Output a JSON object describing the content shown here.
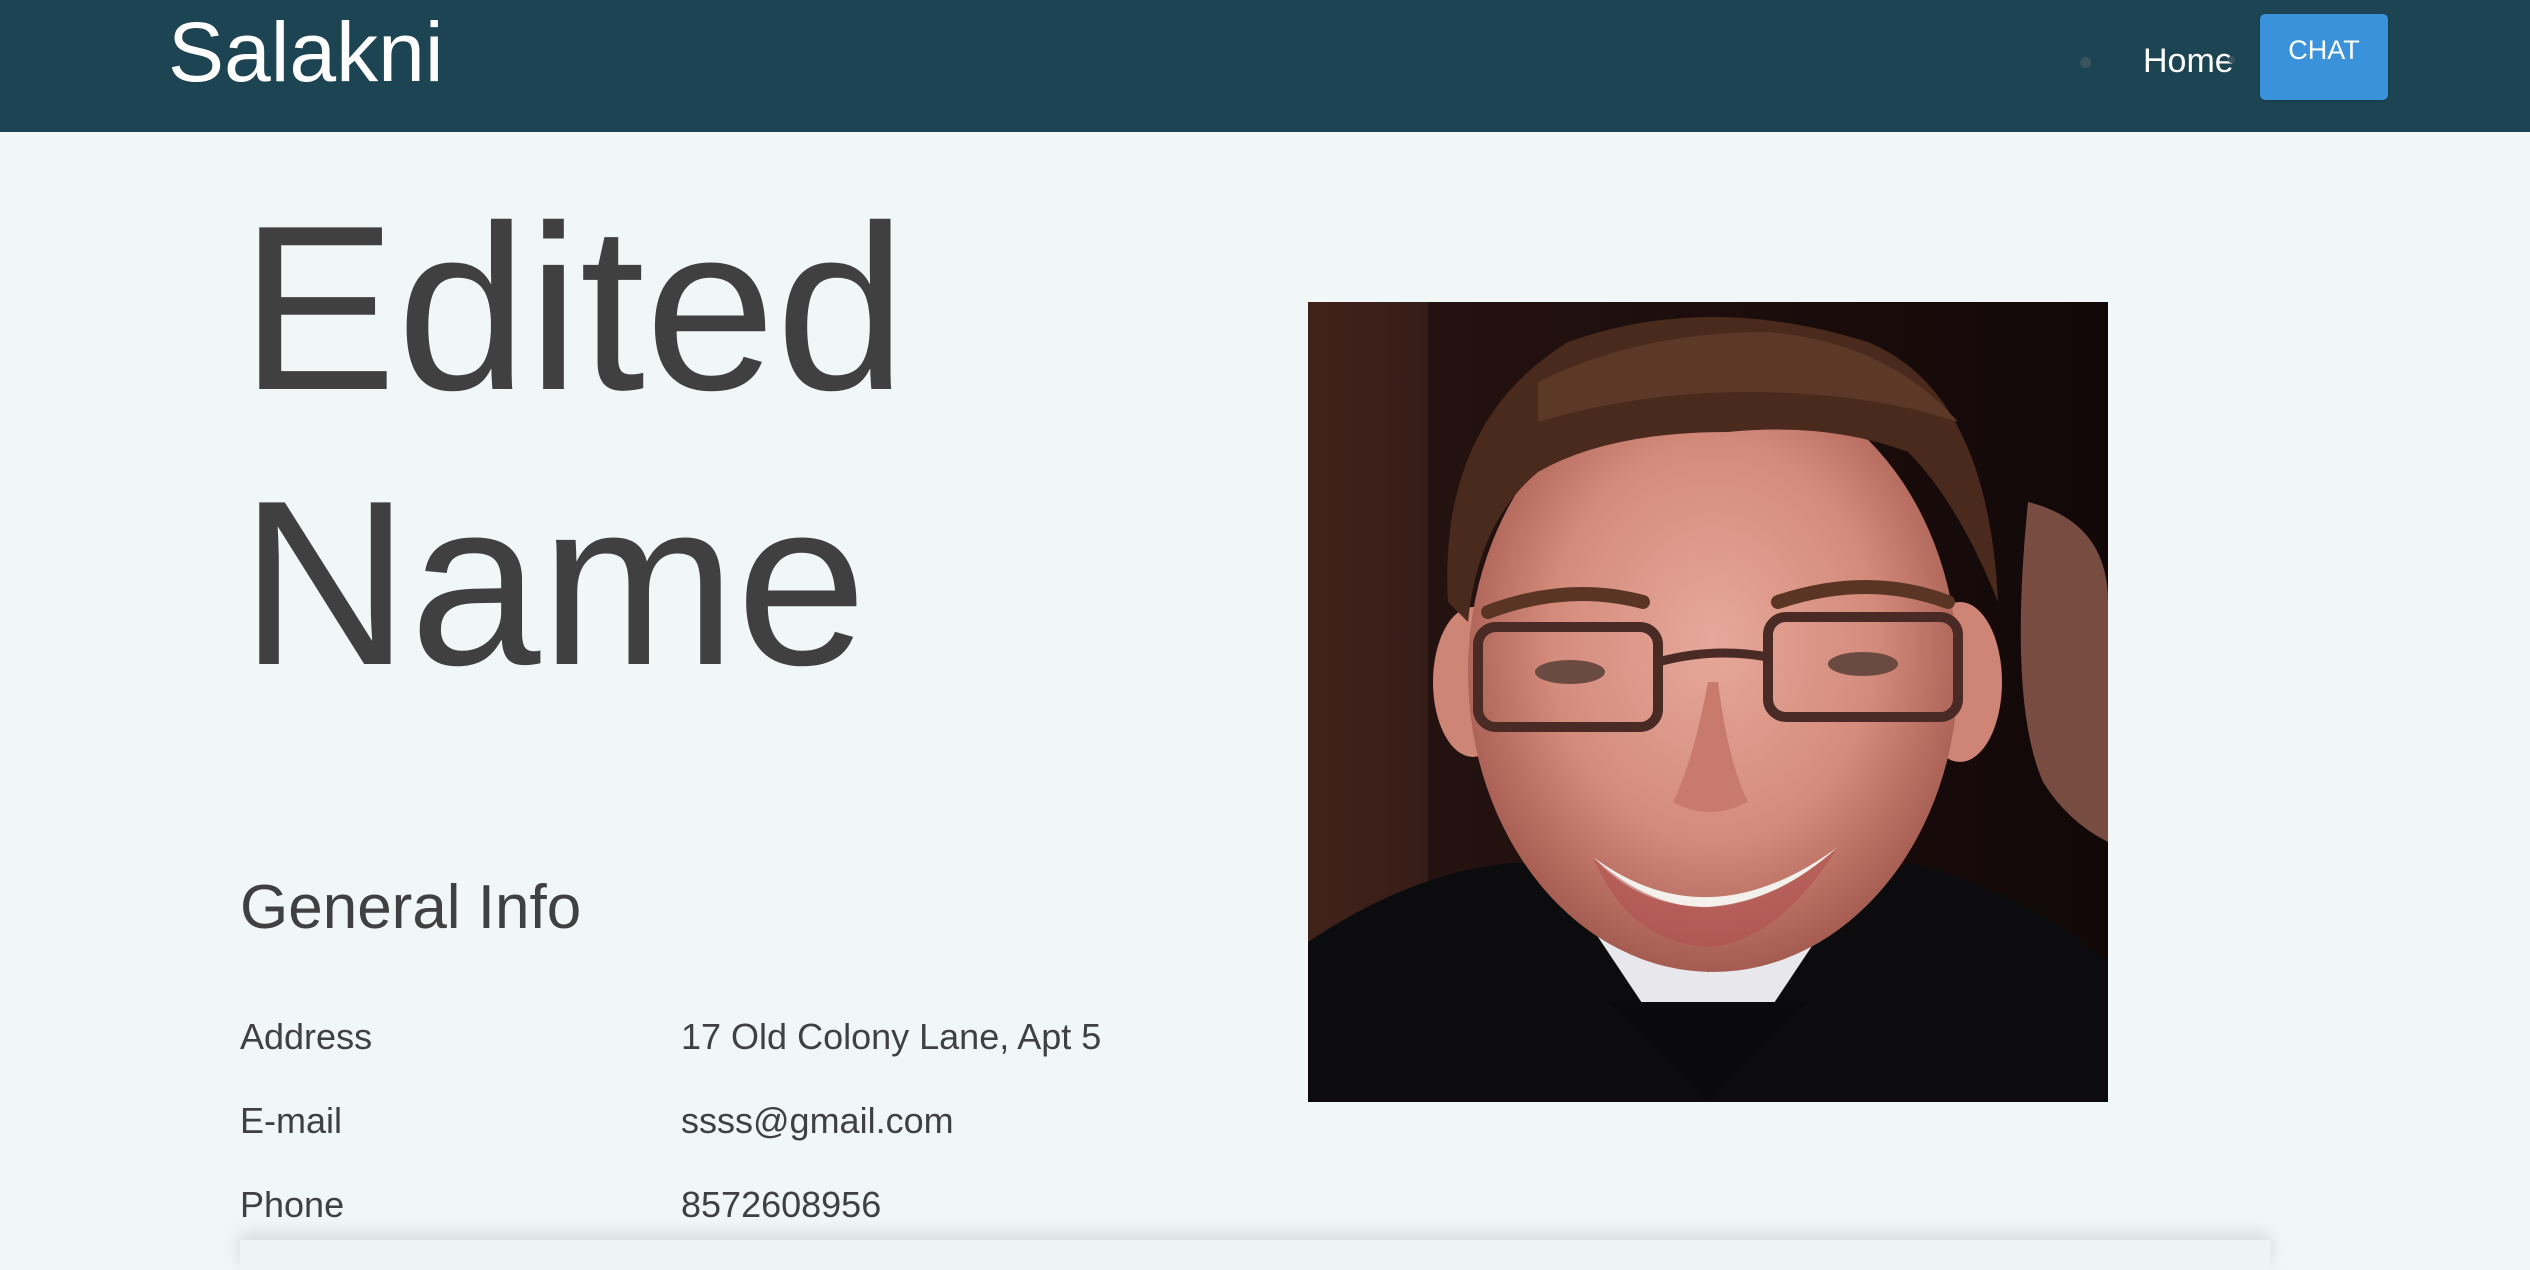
{
  "navbar": {
    "brand": "Salakni",
    "home_label": "Home",
    "chat_label": "CHAT"
  },
  "profile": {
    "name": "Edited Name",
    "section_title": "General Info",
    "info": [
      {
        "label": "Address",
        "value": "17 Old Colony Lane, Apt 5"
      },
      {
        "label": "E-mail",
        "value": "ssss@gmail.com"
      },
      {
        "label": "Phone",
        "value": "8572608956"
      }
    ]
  },
  "colors": {
    "navbar_bg": "#1c4452",
    "page_bg": "#f1f7f7",
    "chat_button": "#3a93da",
    "text": "#404040"
  }
}
